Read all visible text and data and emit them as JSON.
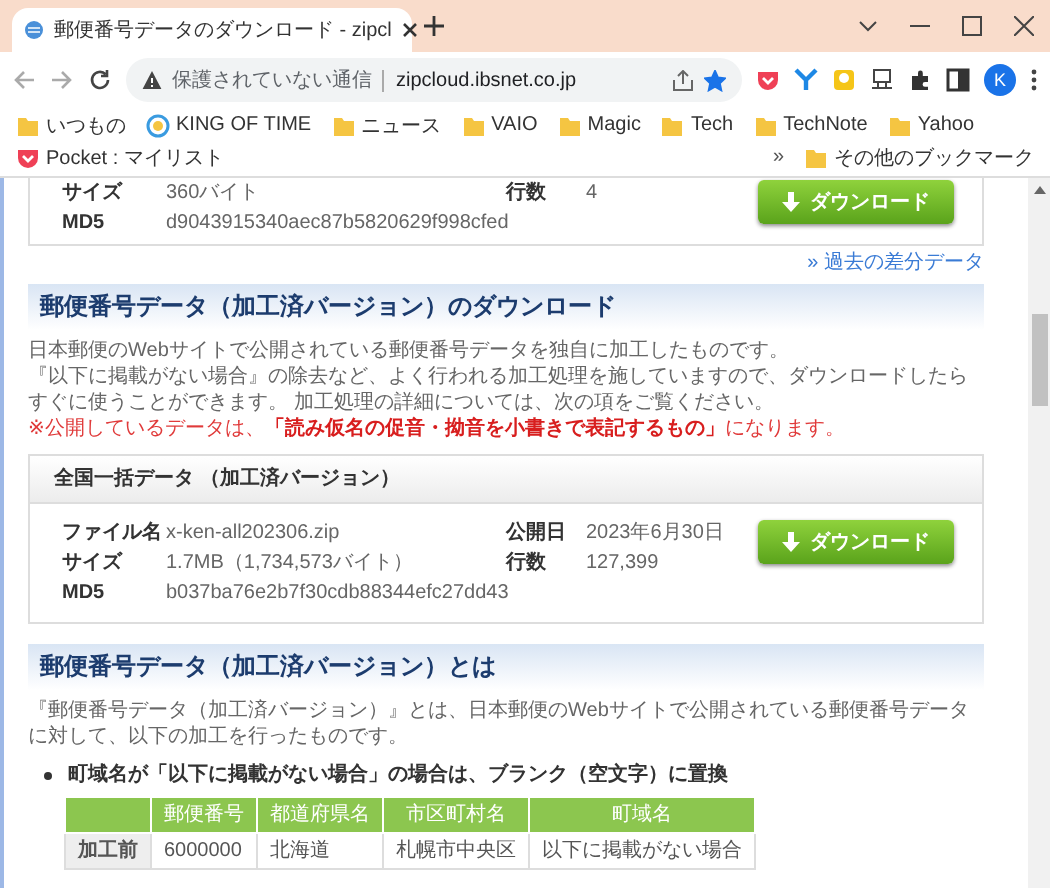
{
  "tab": {
    "title": "郵便番号データのダウンロード - zipcl",
    "selected": true
  },
  "address_bar": {
    "security": "保護されていない通信",
    "url": "zipcloud.ibsnet.co.jp",
    "bookmarked": true
  },
  "profile": {
    "initial": "K"
  },
  "bookmarks": [
    {
      "label": "いつもの",
      "kind": "folder"
    },
    {
      "label": "KING OF TIME",
      "kind": "site"
    },
    {
      "label": "ニュース",
      "kind": "folder"
    },
    {
      "label": "VAIO",
      "kind": "folder"
    },
    {
      "label": "Magic",
      "kind": "folder"
    },
    {
      "label": "Tech",
      "kind": "folder"
    },
    {
      "label": "TechNote",
      "kind": "folder"
    },
    {
      "label": "Yahoo",
      "kind": "folder"
    },
    {
      "label": "Pocket : マイリスト",
      "kind": "pocket"
    }
  ],
  "bookmarks_overflow": "»",
  "other_bookmarks": "その他のブックマーク",
  "previous_data": {
    "rows": [
      {
        "label": "サイズ",
        "value": "360バイト",
        "label2": "行数",
        "value2": "4"
      },
      {
        "label": "MD5",
        "value": "d9043915340aec87b5820629f998cfed"
      }
    ],
    "button": "ダウンロード"
  },
  "past_diff_link": "» 過去の差分データ",
  "section": {
    "heading": "郵便番号データ（加工済バージョン）のダウンロード",
    "paragraphs": [
      "日本郵便のWebサイトで公開されている郵便番号データを独自に加工したものです。",
      "『以下に掲載がない場合』の除去など、よく行われる加工処理を施していますので、ダウンロードしたらすぐに使うことができます。 加工処理の詳細については、次の項をご覧ください。"
    ],
    "note": "※公開しているデータは、**「読み仮名の促音・拗音を小書きで表記するもの」**になります。",
    "card": {
      "title": "全国一括データ （加工済バージョン）",
      "rows": [
        {
          "label": "ファイル名",
          "value": "x-ken-all202306.zip",
          "label2": "公開日",
          "value2": "2023年6月30日"
        },
        {
          "label": "サイズ",
          "value": "1.7MB（1,734,573バイト）",
          "label2": "行数",
          "value2": "127,399"
        },
        {
          "label": "MD5",
          "value": "b037ba76e2b7f30cdb88344efc27dd43"
        }
      ],
      "button": "ダウンロード"
    }
  },
  "about": {
    "heading": "郵便番号データ（加工済バージョン）とは",
    "paragraph": "『郵便番号データ（加工済バージョン）』とは、日本郵便のWebサイトで公開されている郵便番号データに対して、以下の加工を行ったものです。",
    "bullet": "町域名が「以下に掲載がない場合」の場合は、ブランク（空文字）に置換",
    "table": {
      "columns": [
        "郵便番号",
        "都道府県名",
        "市区町村名",
        "町域名"
      ],
      "rows": [
        {
          "label": "加工前",
          "cells": [
            "6000000",
            "北海道",
            "札幌市中央区",
            "以下に掲載がない場合"
          ]
        }
      ]
    }
  }
}
